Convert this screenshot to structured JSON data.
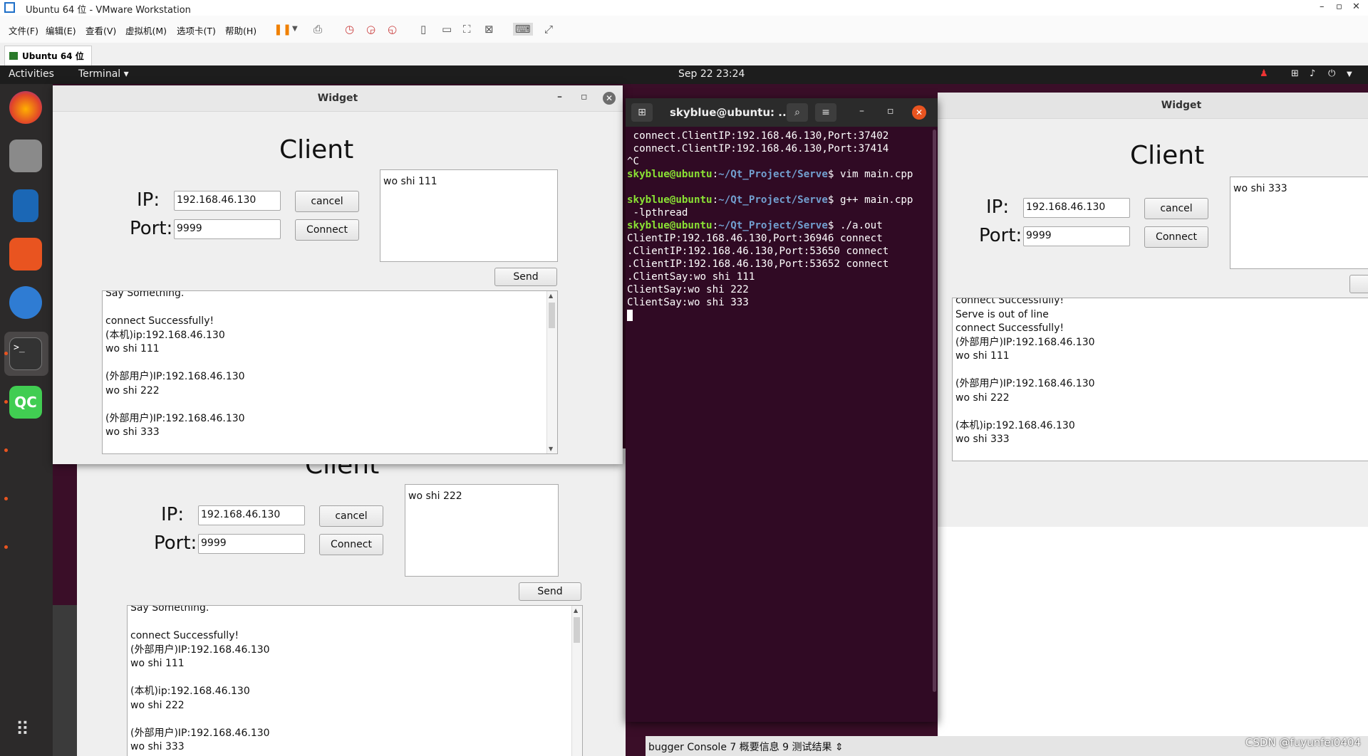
{
  "vmware": {
    "title": "Ubuntu 64 位 - VMware Workstation",
    "menus": [
      "文件(F)",
      "编辑(E)",
      "查看(V)",
      "虚拟机(M)",
      "选项卡(T)",
      "帮助(H)"
    ],
    "tab_label": "Ubuntu 64 位"
  },
  "gnome": {
    "activities": "Activities",
    "app_menu": "Terminal ▾",
    "clock": "Sep 22  23:24"
  },
  "widget_left": {
    "title": "Widget",
    "heading": "Client",
    "ip_label": "IP:",
    "port_label": "Port:",
    "ip_value": "192.168.46.130",
    "port_value": "9999",
    "cancel_label": "cancel",
    "connect_label": "Connect",
    "send_label": "Send",
    "message": "wo shi 111",
    "log": [
      "Say Something.",
      "",
      "connect Successfully!",
      "(本机)ip:192.168.46.130",
      "wo shi 111",
      "",
      "(外部用户)IP:192.168.46.130",
      "wo shi 222",
      "",
      "(外部用户)IP:192.168.46.130",
      "wo shi 333"
    ]
  },
  "widget_bottom": {
    "heading": "Client",
    "ip_label": "IP:",
    "port_label": "Port:",
    "ip_value": "192.168.46.130",
    "port_value": "9999",
    "cancel_label": "cancel",
    "connect_label": "Connect",
    "send_label": "Send",
    "message": "wo shi 222",
    "log": [
      "Say Something.",
      "",
      "connect Successfully!",
      "(外部用户)IP:192.168.46.130",
      "wo shi 111",
      "",
      "(本机)ip:192.168.46.130",
      "wo shi 222",
      "",
      "(外部用户)IP:192.168.46.130",
      "wo shi 333"
    ]
  },
  "widget_right": {
    "title": "Widget",
    "heading": "Client",
    "ip_label": "IP:",
    "port_label": "Port:",
    "ip_value": "192.168.46.130",
    "port_value": "9999",
    "cancel_label": "cancel",
    "connect_label": "Connect",
    "message": "wo shi 333",
    "log": [
      "connect Successfully!",
      "Serve is out of line",
      "connect Successfully!",
      "(外部用户)IP:192.168.46.130",
      "wo shi 111",
      "",
      "(外部用户)IP:192.168.46.130",
      "wo shi 222",
      "",
      "(本机)ip:192.168.46.130",
      "wo shi 333"
    ]
  },
  "terminal": {
    "title": "skyblue@ubuntu: ...",
    "lines": [
      {
        "text": " connect.ClientIP:192.168.46.130,Port:37402"
      },
      {
        "text": " connect.ClientIP:192.168.46.130,Port:37414"
      },
      {
        "text": "^C"
      },
      {
        "user": "skyblue@ubuntu",
        "path": "~/Qt_Project/Serve",
        "cmd": "$ vim main.cpp"
      },
      {
        "text": ""
      },
      {
        "user": "skyblue@ubuntu",
        "path": "~/Qt_Project/Serve",
        "cmd": "$ g++ main.cpp"
      },
      {
        "text": " -lpthread"
      },
      {
        "user": "skyblue@ubuntu",
        "path": "~/Qt_Project/Serve",
        "cmd": "$ ./a.out"
      },
      {
        "text": "ClientIP:192.168.46.130,Port:36946 connect"
      },
      {
        "text": ".ClientIP:192.168.46.130,Port:53650 connect"
      },
      {
        "text": ".ClientIP:192.168.46.130,Port:53652 connect"
      },
      {
        "text": ".ClientSay:wo shi 111"
      },
      {
        "text": "ClientSay:wo shi 222"
      },
      {
        "text": "ClientSay:wo shi 333"
      }
    ]
  },
  "creator": {
    "bottom_tabs": "bugger Console   7 概要信息   9 测试结果   ⇕"
  },
  "watermark": "CSDN @fuyunfei0404"
}
